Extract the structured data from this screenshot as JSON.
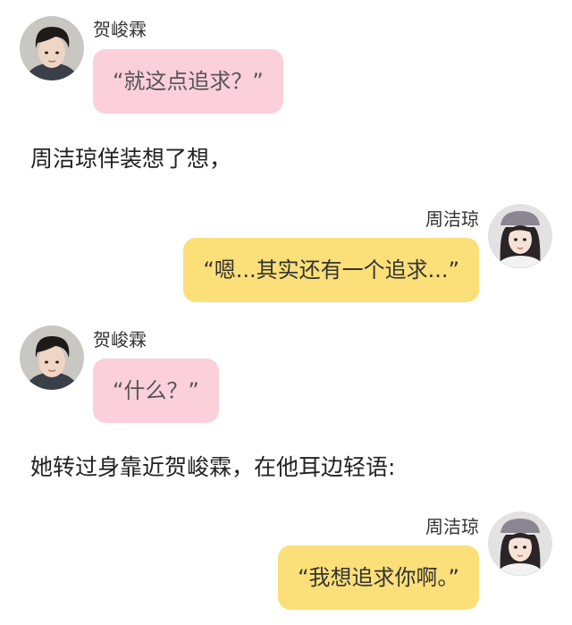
{
  "colors": {
    "pink_bubble": "#fbd0db",
    "yellow_bubble": "#fbdf78",
    "background": "#ffffff"
  },
  "messages": [
    {
      "side": "left",
      "speaker": "贺峻霖",
      "text": "“就这点追求？”",
      "avatar": "male-avatar"
    },
    {
      "side": "right",
      "speaker": "周洁琼",
      "text": "“嗯...其实还有一个追求...”",
      "avatar": "female-avatar"
    },
    {
      "side": "left",
      "speaker": "贺峻霖",
      "text": "“什么？”",
      "avatar": "male-avatar"
    },
    {
      "side": "right",
      "speaker": "周洁琼",
      "text": "“我想追求你啊。”",
      "avatar": "female-avatar"
    }
  ],
  "narrations": [
    "周洁琼佯装想了想，",
    "她转过身靠近贺峻霖，在他耳边轻语:"
  ]
}
